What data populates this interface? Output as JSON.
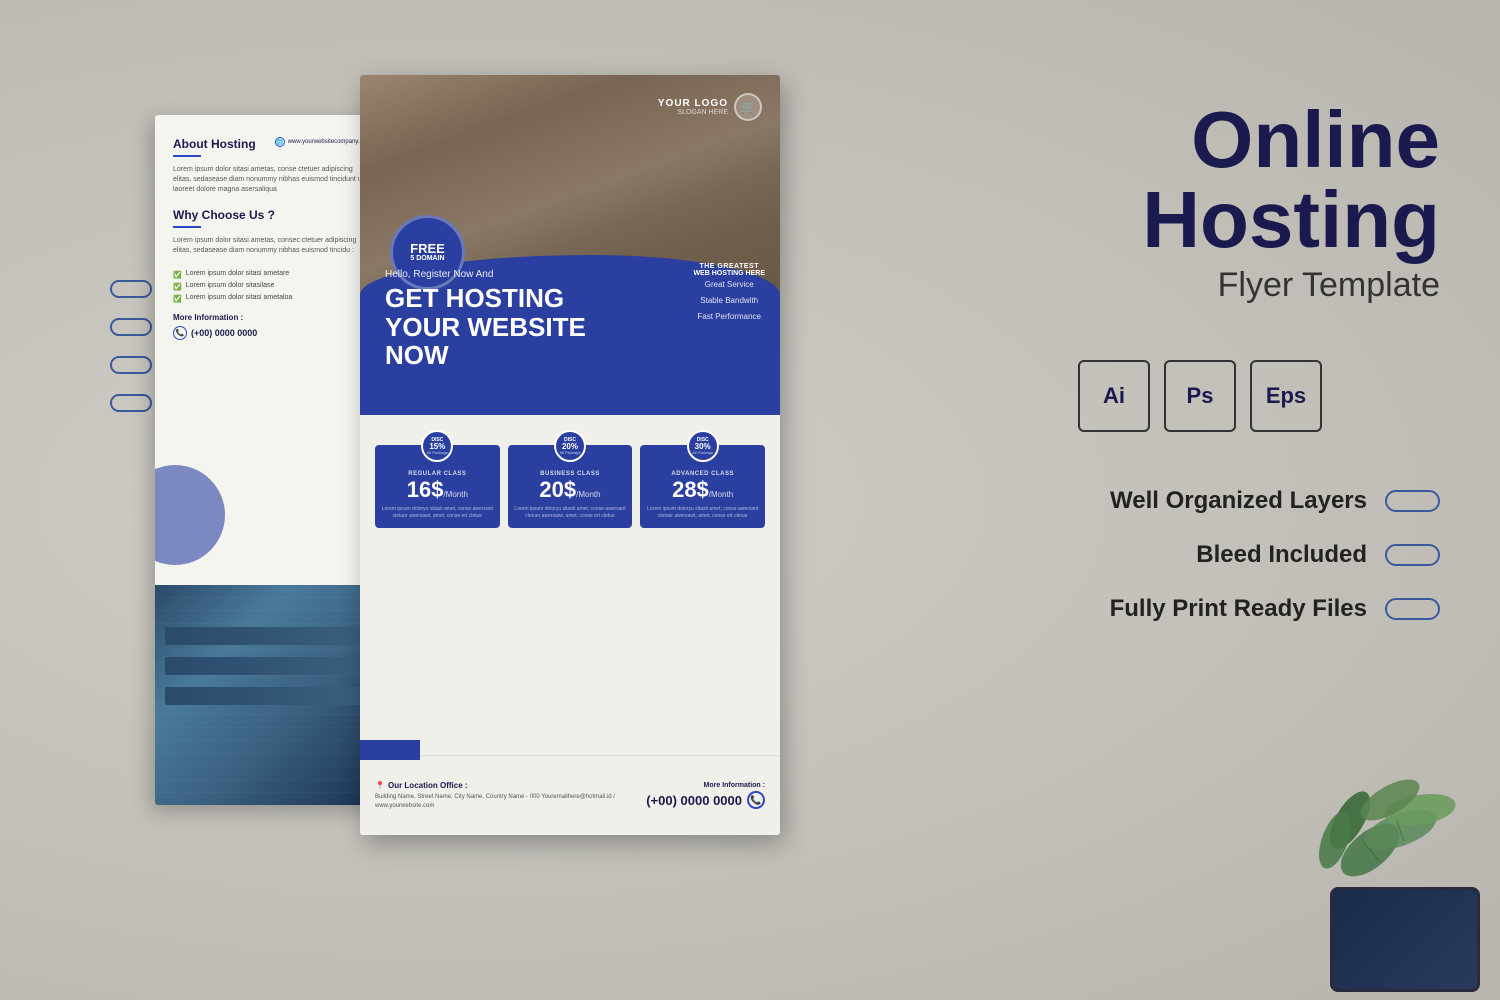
{
  "page": {
    "bg_color": "#c8c5be"
  },
  "back_flyer": {
    "about_title": "About Hosting",
    "about_text": "Lorem ipsum dolor sitasi ametas, conse ctetuer adipiscing elitas, sedasease diam nonummy nibhas euismod tincidunt ut laoreet dolore magna asersaliqua",
    "why_choose_title": "Why Choose Us ?",
    "why_text": "Lorem ipsum dolor sitasi ametas, consec ctetuer adipiscing elitas, sedasease diam nonummy nibhas euismod tincidu :",
    "check_items": [
      "Lorem ipsum dolor sitasi ametare",
      "Lorem ipsum dolor sitasilase",
      "Lorem ipsum dolor sitasi ametaloa"
    ],
    "more_info_label": "More Information :",
    "phone": "(+00) 0000 0000",
    "website": "www.yourwebsitecompany.com"
  },
  "front_flyer": {
    "logo_name": "YOUR LOGO",
    "logo_slogan": "SLOGAN HERE",
    "free_badge_line1": "FREE",
    "free_badge_line2": "5 DOMAIN",
    "register_text": "Hello, Register Now And",
    "heading_line1": "GET HOSTING",
    "heading_line2": "YOUR WEBSITE NOW",
    "greatest_label": "THE GREATEST",
    "web_hosting_label": "WEB HOSTING HERE",
    "service_1": "Great Service",
    "service_2": "Stable Bandwith",
    "service_3": "Fast Performance",
    "pricing": [
      {
        "disc_label": "DISC",
        "disc_percent": "15%",
        "disc_sub": "All Package",
        "class_name": "REGULAR CLASS",
        "price": "16$",
        "period": "/Month",
        "desc": "Lorem ipsum doloryu sitasti amet, conse awerxant cletuer awerxawt, amet, conse ert cletue"
      },
      {
        "disc_label": "DISC",
        "disc_percent": "20%",
        "disc_sub": "All Package",
        "class_name": "BUSINESS CLASS",
        "price": "20$",
        "period": "/Month",
        "desc": "Lorem ipsum doloryu sitasti amet, conse awerxant cletuer awerxawt, amet, conse ert cletue"
      },
      {
        "disc_label": "DISC",
        "disc_percent": "30%",
        "disc_sub": "All Package",
        "class_name": "ADVANCED CLASS",
        "price": "28$",
        "period": "/Month",
        "desc": "Lorem ipsum doloryu sitasti amet, conse awerxant cletuer awerxawt, amet, conse ert cletue"
      }
    ],
    "location_label": "Our Location Office :",
    "location_text": "Building Name, Street Name, City Name, Country Name - 000\nYouremailhere@hotmail.id / www.yourwebsite.com",
    "more_info_label": "More Information :",
    "phone": "(+00) 0000 0000"
  },
  "right_panel": {
    "title_line1": "Online",
    "title_line2": "Hosting",
    "subtitle": "Flyer Template",
    "formats": [
      "Ai",
      "Ps",
      "Eps"
    ],
    "features": [
      "Well Organized Layers",
      "Bleed Included",
      "Fully Print Ready Files"
    ]
  }
}
